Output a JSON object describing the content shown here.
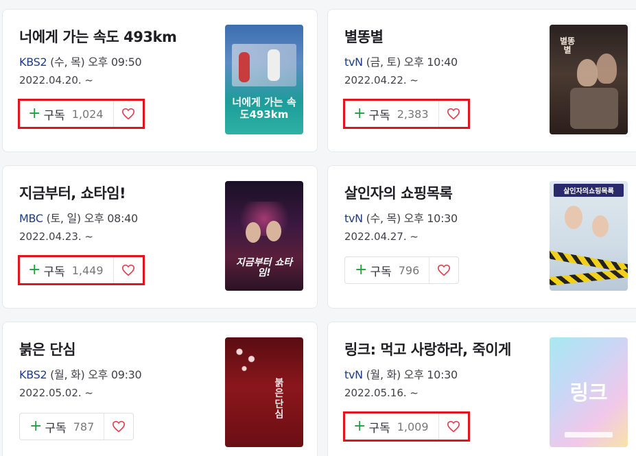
{
  "subscribe_label": "구독",
  "dramas": [
    {
      "title": "너에게 가는 속도 493km",
      "channel": "KBS2",
      "schedule": " (수, 목) 오후 09:50",
      "date": "2022.04.20. ~",
      "count": "1,024",
      "highlighted": true,
      "poster_text": "너에게 가는 속도493km"
    },
    {
      "title": "별똥별",
      "channel": "tvN",
      "schedule": " (금, 토) 오후 10:40",
      "date": "2022.04.22. ~",
      "count": "2,383",
      "highlighted": true,
      "poster_text": "별똥별"
    },
    {
      "title": "지금부터, 쇼타임!",
      "channel": "MBC",
      "schedule": " (토, 일) 오후 08:40",
      "date": "2022.04.23. ~",
      "count": "1,449",
      "highlighted": true,
      "poster_text": "지금부터 쇼타임!"
    },
    {
      "title": "살인자의 쇼핑목록",
      "channel": "tvN",
      "schedule": " (수, 목) 오후 10:30",
      "date": "2022.04.27. ~",
      "count": "796",
      "highlighted": false,
      "poster_text": "살인자의쇼핑목록"
    },
    {
      "title": "붉은 단심",
      "channel": "KBS2",
      "schedule": " (월, 화) 오후 09:30",
      "date": "2022.05.02. ~",
      "count": "787",
      "highlighted": false,
      "poster_text": "붉은단심"
    },
    {
      "title": "링크: 먹고 사랑하라, 죽이게",
      "channel": "tvN",
      "schedule": " (월, 화) 오후 10:30",
      "date": "2022.05.16. ~",
      "count": "1,009",
      "highlighted": true,
      "poster_text": "링크"
    }
  ],
  "colors": {
    "highlight": "#e0141e",
    "plus": "#18a33a",
    "heart": "#e0414f",
    "channel": "#1c3b8a"
  }
}
